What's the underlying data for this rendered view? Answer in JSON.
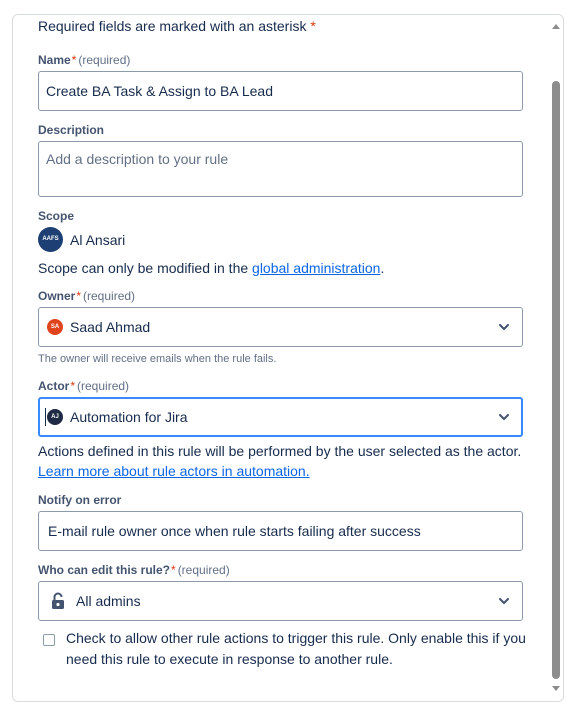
{
  "required_note": {
    "text": "Required fields are marked with an asterisk",
    "asterisk": "*"
  },
  "name": {
    "label": "Name",
    "asterisk": "*",
    "required": "(required)",
    "value": "Create BA Task & Assign to BA Lead"
  },
  "description": {
    "label": "Description",
    "placeholder": "Add a description to your rule"
  },
  "scope": {
    "label": "Scope",
    "avatar_initials": "AAFS",
    "value": "Al Ansari",
    "note_prefix": "Scope can only be modified in the",
    "note_link": "global administration",
    "note_suffix": "."
  },
  "owner": {
    "label": "Owner",
    "asterisk": "*",
    "required": "(required)",
    "avatar_initials": "SA",
    "value": "Saad Ahmad",
    "helper": "The owner will receive emails when the rule fails."
  },
  "actor": {
    "label": "Actor",
    "asterisk": "*",
    "required": "(required)",
    "avatar_initials": "AJ",
    "value": "Automation for Jira",
    "helper": "Actions defined in this rule will be performed by the user selected as the actor.",
    "learn_more": "Learn more about rule actors in automation."
  },
  "notify": {
    "label": "Notify on error",
    "value": "E-mail rule owner once when rule starts failing after success"
  },
  "who_can_edit": {
    "label": "Who can edit this rule?",
    "asterisk": "*",
    "required": "(required)",
    "icon": "unlock-icon",
    "value": "All admins"
  },
  "trigger_checkbox": {
    "label": "Check to allow other rule actions to trigger this rule. Only enable this if you need this rule to execute in response to another rule.",
    "checked": false
  },
  "colors": {
    "accent": "#0c66e4",
    "required": "#de350b",
    "scope_avatar": "#1d3f74",
    "owner_avatar": "#e0441d",
    "actor_avatar": "#1f2a44",
    "focus_border": "#388bff"
  }
}
